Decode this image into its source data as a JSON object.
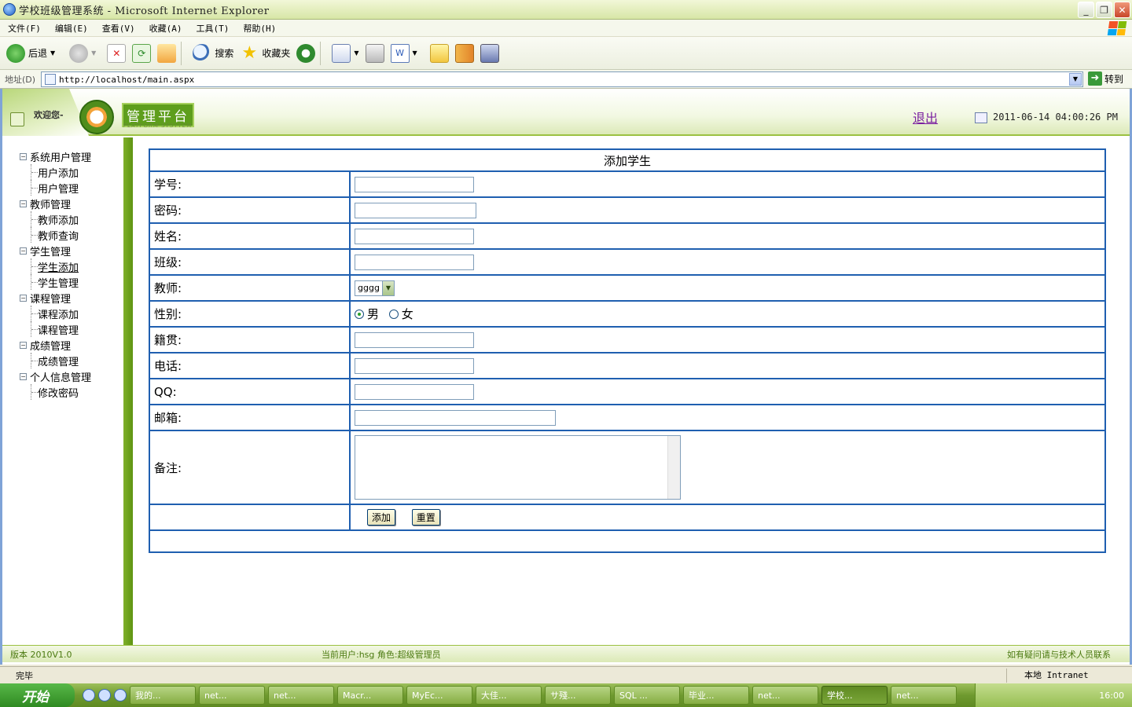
{
  "window": {
    "title": "学校班级管理系统 - Microsoft Internet Explorer"
  },
  "menu": [
    "文件(F)",
    "编辑(E)",
    "查看(V)",
    "收藏(A)",
    "工具(T)",
    "帮助(H)"
  ],
  "toolbar": {
    "back": "后退",
    "search": "搜索",
    "favorites": "收藏夹"
  },
  "address": {
    "label": "地址(D)",
    "url": "http://localhost/main.aspx",
    "go": "转到"
  },
  "header": {
    "welcome": "欢迎您-",
    "brand": "管理平台",
    "brand_sub": "PLATFORM SYSYTEM",
    "logout": "退出",
    "datetime": "2011-06-14 04:00:26 PM"
  },
  "nav": [
    {
      "label": "系统用户管理",
      "children": [
        "用户添加",
        "用户管理"
      ]
    },
    {
      "label": "教师管理",
      "children": [
        "教师添加",
        "教师查询"
      ]
    },
    {
      "label": "学生管理",
      "children": [
        "学生添加",
        "学生管理"
      ]
    },
    {
      "label": "课程管理",
      "children": [
        "课程添加",
        "课程管理"
      ]
    },
    {
      "label": "成绩管理",
      "children": [
        "成绩管理"
      ]
    },
    {
      "label": "个人信息管理",
      "children": [
        "修改密码"
      ]
    }
  ],
  "form": {
    "title": "添加学生",
    "fields": {
      "student_id": "学号:",
      "password": "密码:",
      "name": "姓名:",
      "class": "班级:",
      "teacher": "教师:",
      "gender": "性别:",
      "native": "籍贯:",
      "phone": "电话:",
      "qq": "QQ:",
      "email": "邮箱:",
      "remark": "备注:"
    },
    "teacher_selected": "gggg",
    "gender_male": "男",
    "gender_female": "女",
    "add_button": "添加",
    "reset_button": "重置"
  },
  "footer": {
    "version": "版本 2010V1.0",
    "current_user": "当前用户:hsg 角色:超级管理员",
    "help": "如有疑问请与技术人员联系"
  },
  "status": {
    "text": "完毕",
    "zone": "本地 Intranet"
  },
  "taskbar": {
    "start": "开始",
    "tasks": [
      "我的...",
      "net...",
      "net...",
      "Macr...",
      "MyEc...",
      "大佳...",
      "サ殘...",
      "SQL ...",
      "毕业...",
      "net...",
      "学校...",
      "net..."
    ],
    "clock": "16:00"
  }
}
